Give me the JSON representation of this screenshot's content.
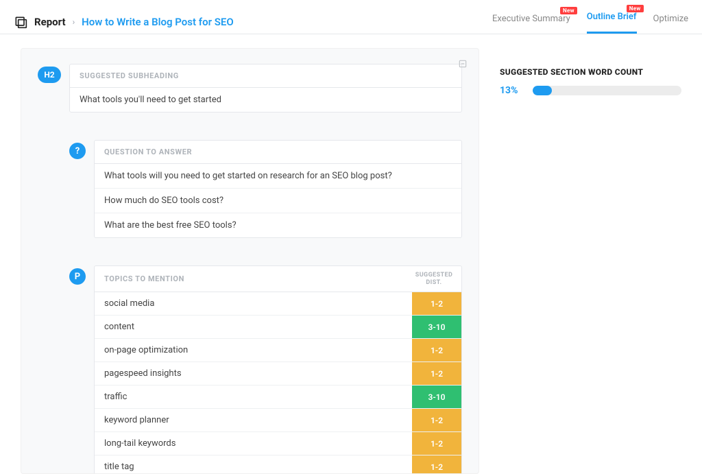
{
  "header": {
    "breadcrumb_root": "Report",
    "breadcrumb_title": "How to Write a Blog Post for SEO",
    "nav": [
      {
        "label": "Executive Summary",
        "badge": "New",
        "active": false
      },
      {
        "label": "Outline Brief",
        "badge": "New",
        "active": true
      },
      {
        "label": "Optimize",
        "badge": null,
        "active": false
      }
    ]
  },
  "subheading": {
    "chip": "H2",
    "section_label": "SUGGESTED SUBHEADING",
    "value": "What tools you'll need to get started"
  },
  "questions": {
    "chip": "?",
    "section_label": "QUESTION TO ANSWER",
    "items": [
      "What tools will you need to get started on research for an SEO blog post?",
      "How much do SEO tools cost?",
      "What are the best free SEO tools?"
    ]
  },
  "topics": {
    "chip": "P",
    "section_label": "TOPICS TO MENTION",
    "dist_label_line1": "SUGGESTED",
    "dist_label_line2": "DIST.",
    "rows": [
      {
        "name": "social media",
        "dist": "1-2",
        "level": "low"
      },
      {
        "name": "content",
        "dist": "3-10",
        "level": "high"
      },
      {
        "name": "on-page optimization",
        "dist": "1-2",
        "level": "low"
      },
      {
        "name": "pagespeed insights",
        "dist": "1-2",
        "level": "low"
      },
      {
        "name": "traffic",
        "dist": "3-10",
        "level": "high"
      },
      {
        "name": "keyword planner",
        "dist": "1-2",
        "level": "low"
      },
      {
        "name": "long-tail keywords",
        "dist": "1-2",
        "level": "low"
      },
      {
        "name": "title tag",
        "dist": "1-2",
        "level": "low"
      }
    ]
  },
  "sidebar": {
    "title": "SUGGESTED SECTION WORD COUNT",
    "percent_label": "13%",
    "percent_value": 13
  }
}
